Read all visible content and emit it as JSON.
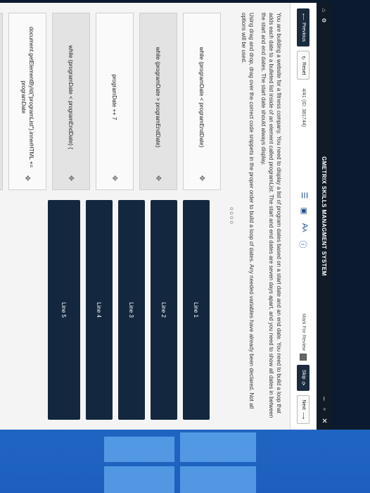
{
  "window": {
    "title": "GMETRIX SKILLS MANAGMENT SYSTEM",
    "controls": [
      "–",
      "▫",
      "✕"
    ]
  },
  "toolbar": {
    "previous": "Previous",
    "reset": "Reset",
    "counter": "4/41 (ID: 381744)",
    "mark_review": "Mark For Review",
    "skip": "Skip",
    "next": "Next"
  },
  "question": {
    "para1": "You are building a website for a fitness company. You need to display a list of program dates based on a start date and an end date. You need to build a loop that adds each date to a bulleted list inside of an element called programList. The start and end dates are seven days apart, and you need to show all dates in between the start and end dates. The start date should always display.",
    "para2": "Using drag and drop, drag over the correct code snippets in the proper order to build a loop of dates. Any needed variables have already been declared. Not all options will be used.",
    "divider": "oooo"
  },
  "snippets": [
    {
      "code": "while (programDate < programEndDate)"
    },
    {
      "code": "while (programDate > programEndDate)"
    },
    {
      "code": "programDate ++ 7"
    },
    {
      "code": "while (programDate < programEndDate) {"
    },
    {
      "code": "document.getElementById(\"programList\").innerHTML += programDate"
    },
    {
      "code": "}"
    }
  ],
  "targets": [
    "Line 1",
    "Line 2",
    "Line 3",
    "Line 4",
    "Line 5"
  ],
  "icons": {
    "home": "home-icon",
    "settings": "gear-icon",
    "grip": "move-icon"
  }
}
